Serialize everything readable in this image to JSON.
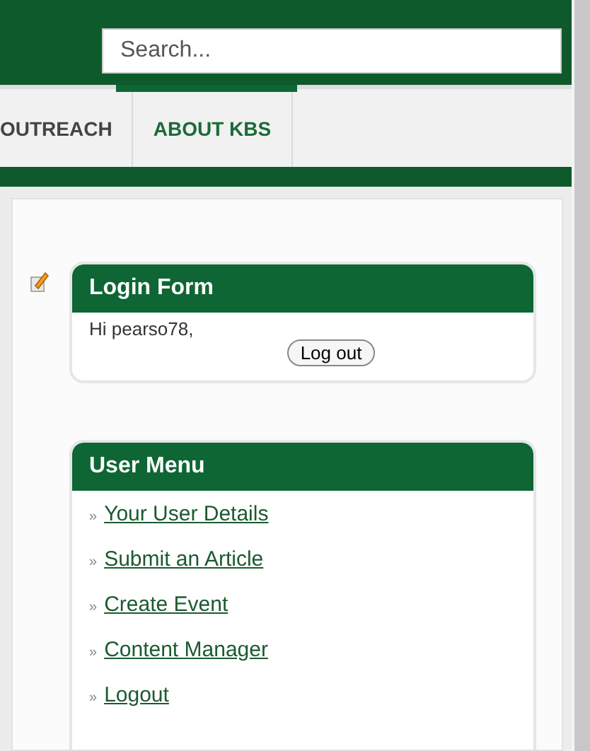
{
  "header": {
    "search": {
      "placeholder": "Search..."
    }
  },
  "nav": {
    "tabs": [
      {
        "label": "OUTREACH",
        "selected": false
      },
      {
        "label": "ABOUT KBS",
        "selected": true
      }
    ]
  },
  "login_form": {
    "title": "Login Form",
    "greeting": "Hi pearso78,",
    "button": "Log out"
  },
  "user_menu": {
    "title": "User Menu",
    "items": [
      {
        "bullet": "»",
        "label": "Your User Details"
      },
      {
        "bullet": "»",
        "label": "Submit an Article"
      },
      {
        "bullet": "»",
        "label": "Create Event"
      },
      {
        "bullet": "»",
        "label": "Content Manager"
      },
      {
        "bullet": "»",
        "label": "Logout"
      }
    ]
  }
}
